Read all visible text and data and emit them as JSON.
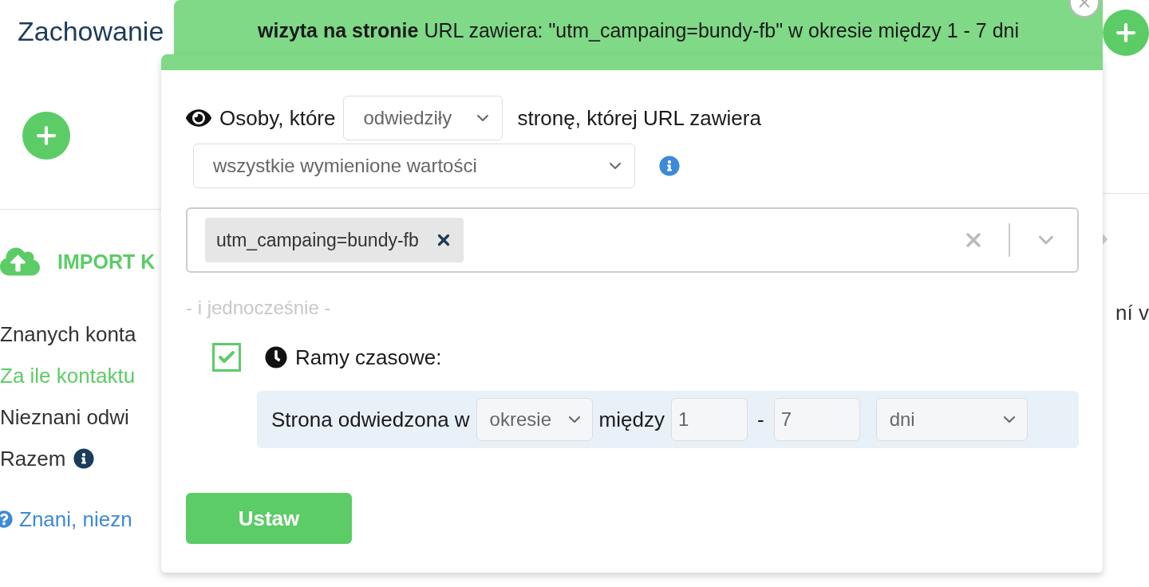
{
  "page": {
    "title": "Zachowanie",
    "import_label": "IMPORT K",
    "stats": [
      {
        "kind": "plain",
        "text": "Znanych konta"
      },
      {
        "kind": "link",
        "text": "Za ile kontaktu"
      },
      {
        "kind": "plain",
        "text": "Nieznani odwi"
      },
      {
        "kind": "info",
        "text": "Razem"
      }
    ],
    "help_link": "Znani, niezn",
    "right_text": "ní v"
  },
  "popup": {
    "header": "**wizyta na stronie** URL zawiera: \"utm_campaing=bundy-fb\" w okresie między 1 - 7 dni",
    "who_label": "Osoby, które",
    "verb_select": "odwiedziły",
    "page_label": "stronę, której URL zawiera",
    "match_select": "wszystkie wymienione wartości",
    "tags": [
      {
        "text": "utm_campaing=bundy-fb"
      }
    ],
    "separator": "- i jednocześnie -",
    "timeframe": {
      "checked": true,
      "label": "Ramy czasowe:",
      "prefix": "Strona odwiedzona w",
      "mode_select": "okresie",
      "between": "między",
      "from": "1",
      "dash": "-",
      "to": "7",
      "unit_select": "dni"
    },
    "button": "Ustaw"
  }
}
